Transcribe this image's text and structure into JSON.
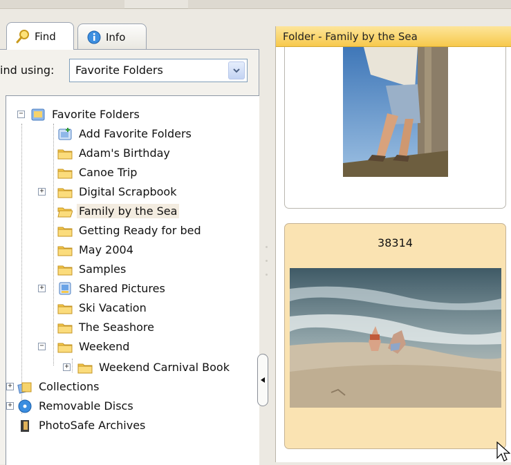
{
  "tabs": [
    {
      "label": "Find",
      "icon": "magnifier-icon"
    },
    {
      "label": "Info",
      "icon": "info-icon"
    }
  ],
  "find_using": {
    "label": "ind using:",
    "value": "Favorite Folders"
  },
  "tree": {
    "root": "Favorite Folders",
    "items": [
      "Add Favorite Folders",
      "Adam's Birthday",
      "Canoe Trip",
      "Digital Scrapbook",
      "Family by the Sea",
      "Getting Ready for bed",
      "May 2004",
      "Samples",
      "Shared Pictures",
      "Ski Vacation",
      "The Seashore",
      "Weekend"
    ],
    "weekend_child": "Weekend Carnival Book",
    "bottom": [
      "Collections",
      "Removable Discs",
      "PhotoSafe Archives"
    ]
  },
  "viewer": {
    "header": "Folder - Family by the Sea",
    "second_card_label": "38314"
  },
  "colors": {
    "header_yellow": "#f7c94c",
    "selected_card": "#fae3b2",
    "folder_yellow": "#f5c84a"
  }
}
